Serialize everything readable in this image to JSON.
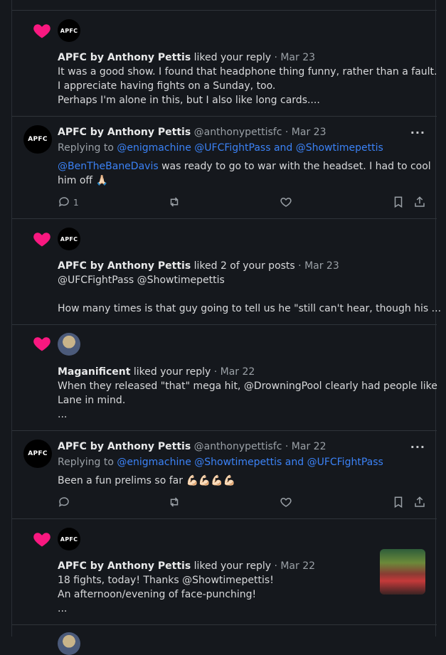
{
  "items": [
    {
      "avatar_label": "APFC",
      "name": "APFC by Anthony Pettis",
      "action": "liked your reply",
      "date": "· Mar 23",
      "lines": [
        "It was a good show. I found that headphone thing funny, rather than a fault.",
        "I appreciate having fights on a Sunday, too.",
        "Perhaps I'm alone in this, but I also like long cards...."
      ]
    },
    {
      "avatar_label": "APFC",
      "name": "APFC by Anthony Pettis",
      "handle": "@anthonypettisfc",
      "date": "· Mar 23",
      "replying_prefix": "Replying to",
      "replying_to": "@enigmachine @UFCFightPass and @Showtimepettis",
      "mention": "@BenTheBaneDavis",
      "text1": " was ready to go to war with the headset. I had to cool",
      "text2": "him off 🙏🏻",
      "reply_count": "1"
    },
    {
      "avatar_label": "APFC",
      "name": "APFC by Anthony Pettis",
      "action": "liked 2 of your posts",
      "date": "· Mar 23",
      "lines": [
        "@UFCFightPass @Showtimepettis",
        "",
        "How many times is that guy going to tell us he \"still can't hear, though his ..."
      ]
    },
    {
      "name": "Maganificent",
      "action": "liked your reply",
      "date": "· Mar 22",
      "lines": [
        "When they released \"that\" mega hit, @DrowningPool clearly had people like",
        "Lane in mind.",
        "..."
      ]
    },
    {
      "avatar_label": "APFC",
      "name": "APFC by Anthony Pettis",
      "handle": "@anthonypettisfc",
      "date": "· Mar 22",
      "replying_prefix": "Replying to",
      "replying_to": "@enigmachine @Showtimepettis and @UFCFightPass",
      "text": "Been a fun prelims so far 💪🏻💪🏻💪🏻💪🏻"
    },
    {
      "avatar_label": "APFC",
      "name": "APFC by Anthony Pettis",
      "action": "liked your reply",
      "date": "· Mar 22",
      "lines": [
        "18 fights, today! Thanks @Showtimepettis!",
        "An afternoon/evening of face-punching!",
        "..."
      ]
    }
  ],
  "more_label": "···",
  "colors": {
    "heart": "#f91880",
    "link": "#3b82f6",
    "background": "#15181d"
  }
}
